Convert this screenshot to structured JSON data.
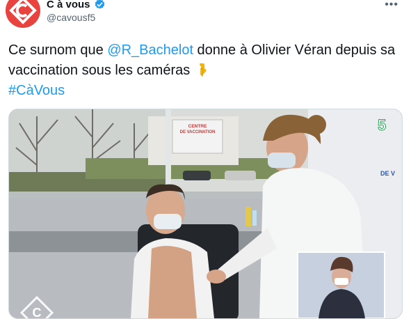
{
  "account": {
    "display_name": "C à vous",
    "handle": "@cavousf5",
    "verified": true,
    "avatar_color": "#e8433f"
  },
  "tweet": {
    "text_part1": "Ce surnom que ",
    "mention": "@R_Bachelot",
    "text_part2": " donne à Olivier Véran depuis sa vaccination sous les caméras ",
    "emoji": "backhand-index-pointing-down",
    "hashtag": "#CàVous"
  },
  "media": {
    "sign_line1": "CENTRE",
    "sign_line2": "DE VACCINATION",
    "channel_badge": "5",
    "wall_text": "DE V",
    "watermark": "C"
  },
  "colors": {
    "link": "#1d9bf0",
    "text": "#0f1419",
    "secondary": "#536471"
  }
}
